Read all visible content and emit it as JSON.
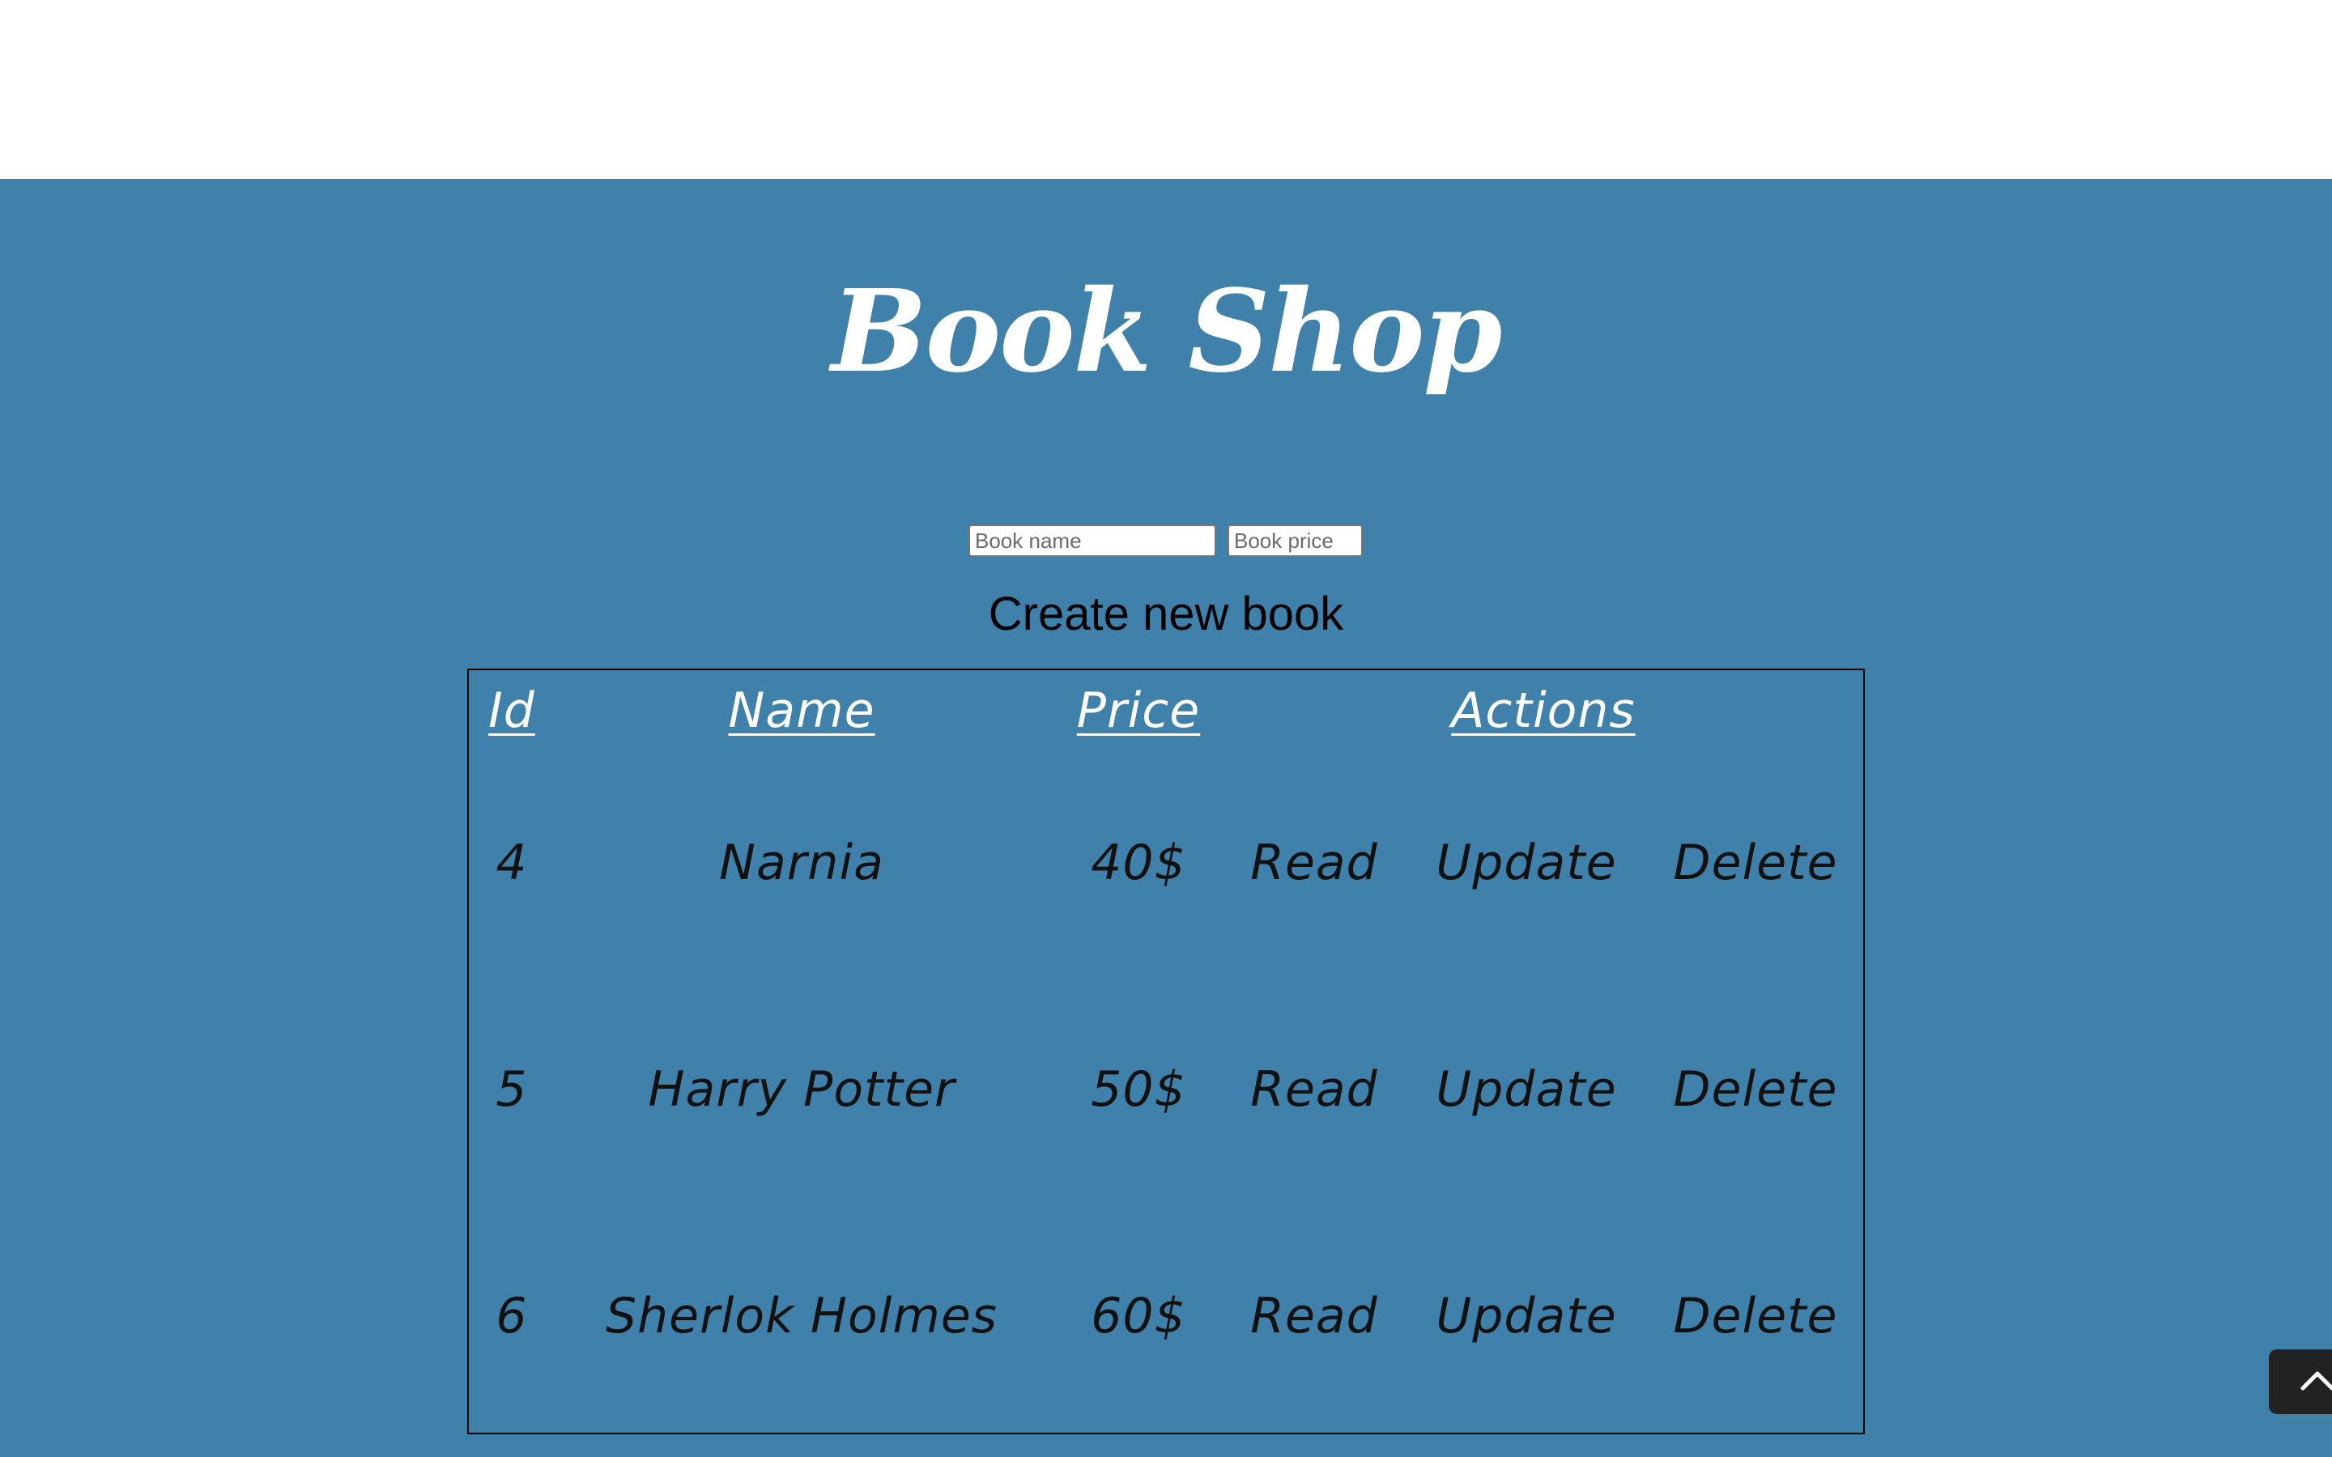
{
  "app": {
    "title": "Book Shop"
  },
  "form": {
    "name_placeholder": "Book name",
    "price_placeholder": "Book price",
    "create_label": "Create new book"
  },
  "table": {
    "headers": {
      "id": "Id",
      "name": "Name",
      "price": "Price",
      "actions": "Actions"
    },
    "rows": [
      {
        "id": "4",
        "name": "Narnia",
        "price": "40$",
        "read": "Read",
        "update": "Update",
        "delete": "Delete"
      },
      {
        "id": "5",
        "name": "Harry Potter",
        "price": "50$",
        "read": "Read",
        "update": "Update",
        "delete": "Delete"
      },
      {
        "id": "6",
        "name": "Sherlok Holmes",
        "price": "60$",
        "read": "Read",
        "update": "Update",
        "delete": "Delete"
      }
    ]
  },
  "scroll_top": {
    "icon": "chevron-up-icon"
  },
  "colors": {
    "background": "#3f81aa",
    "header_text": "#ffffff",
    "body_text": "#111111"
  }
}
